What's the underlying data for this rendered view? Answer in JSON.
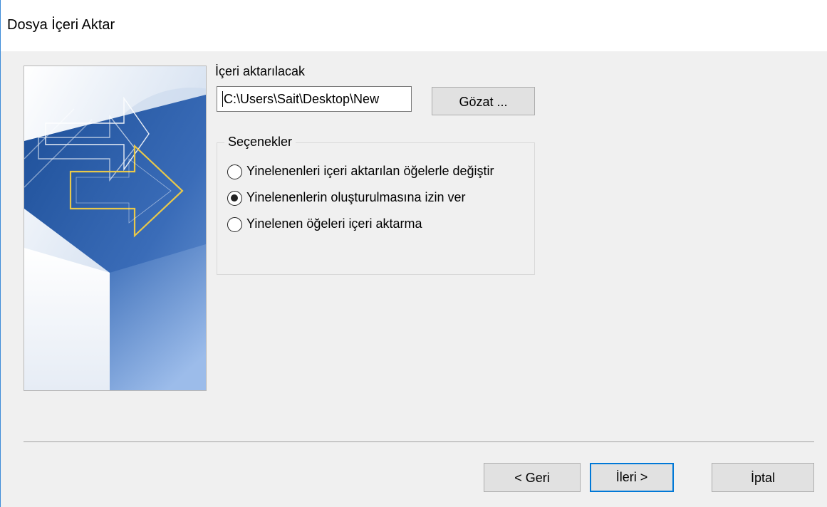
{
  "window": {
    "title": "Dosya İçeri Aktar"
  },
  "import_file": {
    "label": "İçeri aktarılacak",
    "path_value": "C:\\Users\\Sait\\Desktop\\New",
    "browse_label": "Gözat ..."
  },
  "options": {
    "legend": "Seçenekler",
    "items": [
      {
        "label": "Yinelenenleri içeri aktarılan öğelerle değiştir",
        "checked": false
      },
      {
        "label": "Yinelenenlerin oluşturulmasına izin ver",
        "checked": true
      },
      {
        "label": "Yinelenen öğeleri içeri aktarma",
        "checked": false
      }
    ]
  },
  "footer": {
    "back_label": "< Geri",
    "next_label": "İleri >",
    "cancel_label": "İptal"
  },
  "colors": {
    "accent": "#0078d7",
    "art_blue_dark": "#2f5fa8",
    "art_arrow_gold": "#e8c84a"
  },
  "icons": {
    "wizard_art": "import-arrows-illustration"
  }
}
